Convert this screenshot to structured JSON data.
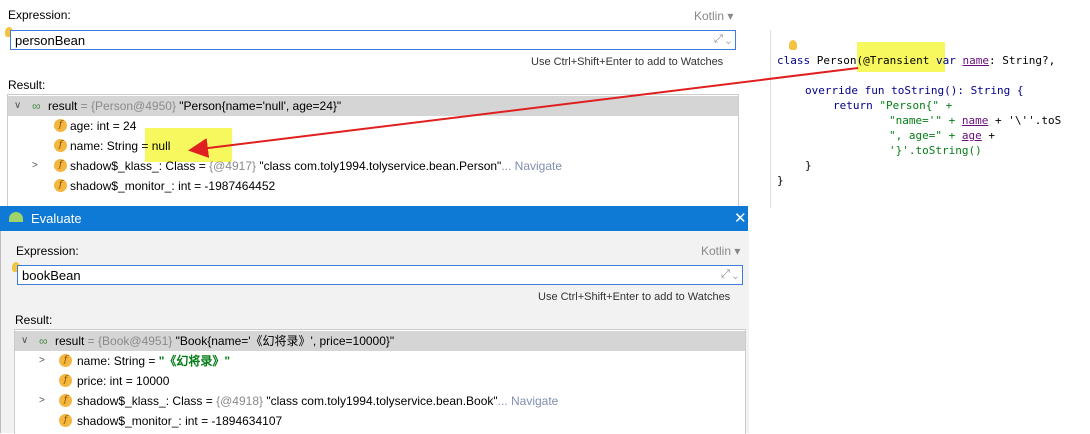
{
  "top": {
    "expression_label": "Expression:",
    "lang": "Kotlin",
    "input_value": "personBean",
    "hint": "Use Ctrl+Shift+Enter to add to Watches",
    "result_label": "Result:",
    "rows": [
      {
        "name": "result",
        "eq": " = ",
        "ref": "{Person@4950}",
        "val": " \"Person{name='null', age=24}\""
      },
      {
        "name": "age",
        "type": ": int",
        "eq": "  = 24"
      },
      {
        "name": "name",
        "type": ": String",
        "eq": "  = null"
      },
      {
        "name": "shadow$_klass_",
        "type": ": Class",
        "eq": "  = ",
        "ref": "{@4917}",
        "val": " \"class com.toly1994.tolyservice.bean.Person\"",
        "link": "... Navigate"
      },
      {
        "name": "shadow$_monitor_",
        "type": ": int",
        "eq": "  = -1987464452"
      }
    ]
  },
  "dialog": {
    "title": "Evaluate",
    "expression_label": "Expression:",
    "lang": "Kotlin",
    "input_value": "bookBean",
    "hint": "Use Ctrl+Shift+Enter to add to Watches",
    "result_label": "Result:",
    "rows": [
      {
        "name": "result",
        "eq": " = ",
        "ref": "{Book@4951}",
        "val": " \"Book{name='《幻将录》', price=10000}\""
      },
      {
        "name": "name",
        "type": ": String",
        "eq": "  = ",
        "str": "\"《幻将录》\""
      },
      {
        "name": "price",
        "type": ": int",
        "eq": "  = 10000"
      },
      {
        "name": "shadow$_klass_",
        "type": ": Class",
        "eq": "  = ",
        "ref": "{@4918}",
        "val": " \"class com.toly1994.tolyservice.bean.Book\"",
        "link": "... Navigate"
      },
      {
        "name": "shadow$_monitor_",
        "type": ": int",
        "eq": "  = -1894634107"
      }
    ]
  },
  "code": {
    "line1_a": "class ",
    "line1_b": "Person",
    "line1_c": "(@Transient ",
    "line1_d": "var ",
    "line1_e": "name",
    "line1_f": ": String?, ",
    "line2": "override fun toString(): String {",
    "line3_a": "return ",
    "line3_b": "\"Person{\" +",
    "line4_a": "\"name='\" + ",
    "line4_b": "name",
    "line4_c": " + '\\''.toS",
    "line5_a": "\", age=\" + ",
    "line5_b": "age",
    "line5_c": " +",
    "line6": "'}'.toString()",
    "line7": "}",
    "line8": "}"
  },
  "colors": {
    "accent": "#0f7ad6",
    "highlight": "#f7f75e",
    "arrow": "#e02020"
  }
}
